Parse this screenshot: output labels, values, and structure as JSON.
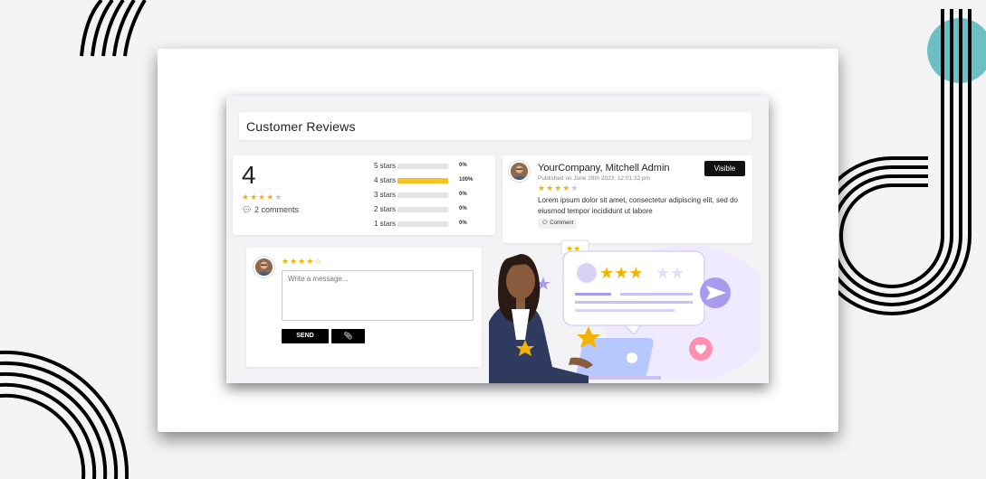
{
  "page": {
    "title": "Customer Reviews"
  },
  "summary": {
    "average": "4",
    "rating": 4,
    "max_rating": 5,
    "comments": "2 comments",
    "breakdown": [
      {
        "label": "5 stars",
        "pct": "0%",
        "fill": 0
      },
      {
        "label": "4 stars",
        "pct": "100%",
        "fill": 100
      },
      {
        "label": "3 stars",
        "pct": "0%",
        "fill": 0
      },
      {
        "label": "2 stars",
        "pct": "0%",
        "fill": 0
      },
      {
        "label": "1 stars",
        "pct": "0%",
        "fill": 0
      }
    ]
  },
  "review": {
    "author": "YourCompany, Mitchell Admin",
    "published": "Published on June 28th 2023, 12:01:32 pm",
    "rating": 4,
    "visible_label": "Visible",
    "text": "Lorem ipsum dolor sit amet, consectetur adipiscing elit, sed do eiusmod tempor incididunt ut labore",
    "comment_label": "Comment"
  },
  "compose": {
    "rating": 4,
    "placeholder": "Write a message...",
    "send_label": "SEND",
    "attach_icon": "paperclip-icon"
  },
  "colors": {
    "star": "#f5b301",
    "bar_fill": "#f6c224",
    "accent_purple": "#a99af0",
    "teal_circle": "#6cbfc4"
  }
}
